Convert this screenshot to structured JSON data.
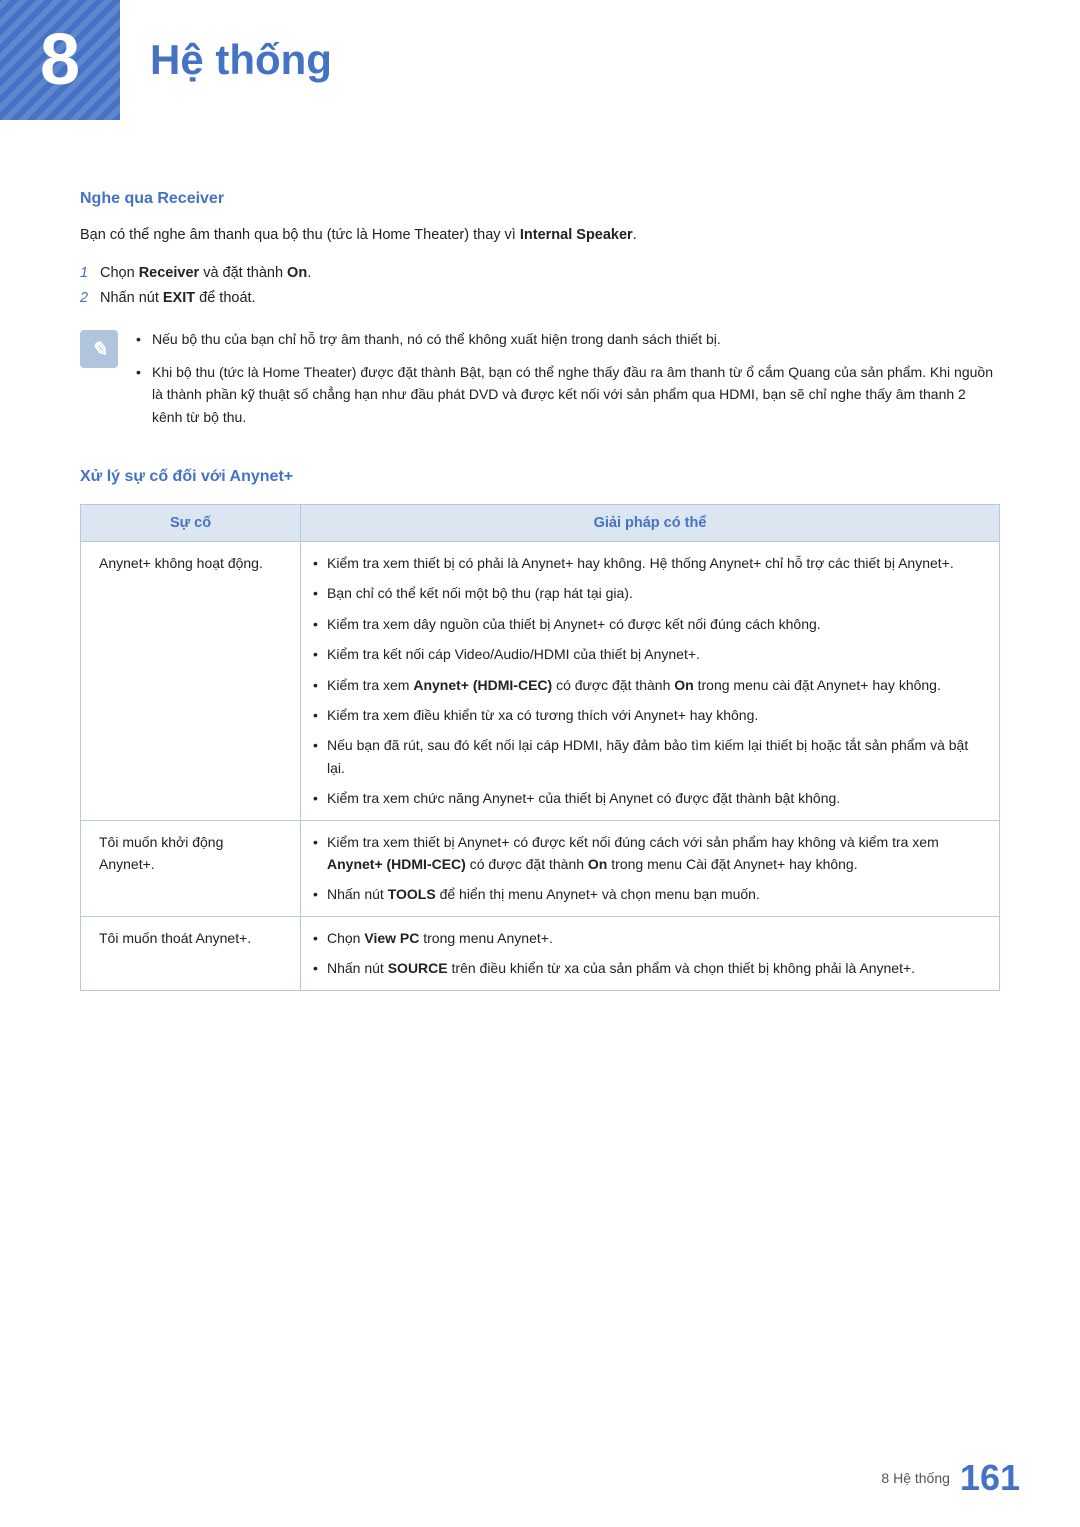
{
  "chapter": {
    "number": "8",
    "title": "Hệ thống"
  },
  "section1": {
    "heading": "Nghe qua Receiver",
    "intro": "Bạn có thể nghe âm thanh qua bộ thu (tức là Home Theater) thay vì ",
    "intro_bold": "Internal Speaker",
    "intro_end": ".",
    "steps": [
      {
        "num": "1",
        "text": "Chọn ",
        "bold": "Receiver",
        "text2": " và đặt thành ",
        "bold2": "On",
        "text3": "."
      },
      {
        "num": "2",
        "text": "Nhấn nút ",
        "bold": "EXIT",
        "text2": " để thoát."
      }
    ],
    "notes": [
      "Nếu bộ thu của bạn chỉ hỗ trợ âm thanh, nó có thể không xuất hiện trong danh sách thiết bị.",
      "Khi bộ thu (tức là Home Theater) được đặt thành Bật, bạn có thể nghe thấy đầu ra âm thanh từ ổ cắm Quang của sản phẩm. Khi nguồn là thành phần kỹ thuật số chẳng hạn như đầu phát DVD và được kết nối với sản phẩm qua HDMI, bạn sẽ chỉ nghe thấy âm thanh 2 kênh từ bộ thu."
    ]
  },
  "section2": {
    "heading": "Xử lý sự cố đối với Anynet+",
    "table": {
      "col1_header": "Sự cố",
      "col2_header": "Giải pháp có thể",
      "rows": [
        {
          "issue": "Anynet+ không hoạt động.",
          "solutions": [
            "Kiểm tra xem thiết bị có phải là Anynet+ hay không. Hệ thống Anynet+ chỉ hỗ trợ các thiết bị Anynet+.",
            "Bạn chỉ có thể kết nối một bộ thu (rạp hát tại gia).",
            "Kiểm tra xem dây nguồn của thiết bị Anynet+ có được kết nối đúng cách không.",
            "Kiểm tra kết nối cáp Video/Audio/HDMI của thiết bị Anynet+.",
            "Kiểm tra xem Anynet+ (HDMI-CEC) có được đặt thành On trong menu cài đặt Anynet+ hay không.",
            "Kiểm tra xem điều khiển từ xa có tương thích với Anynet+ hay không.",
            "Nếu bạn đã rút, sau đó kết nối lại cáp HDMI, hãy đảm bảo tìm kiếm lại thiết bị hoặc tắt sản phẩm và bật lại.",
            "Kiểm tra xem chức năng Anynet+ của thiết bị Anynet có được đặt thành bật không."
          ],
          "solutions_bold": [
            {
              "index": 4,
              "phrase": "Anynet+ (HDMI-CEC)",
              "after": " có được đặt thành ",
              "bold2": "On"
            }
          ]
        },
        {
          "issue": "Tôi muốn khởi động Anynet+.",
          "solutions": [
            "Kiểm tra xem thiết bị Anynet+ có được kết nối đúng cách với sản phẩm hay không và kiểm tra xem Anynet+ (HDMI-CEC) có được đặt thành On trong menu Cài đặt Anynet+ hay không.",
            "Nhấn nút TOOLS để hiển thị menu Anynet+ và chọn menu bạn muốn."
          ],
          "solutions_bold": [
            {
              "index": 0,
              "phrase": "Anynet+ (HDMI-CEC)",
              "after": " có được đặt thành ",
              "bold2": "On"
            },
            {
              "index": 1,
              "phrase": "TOOLS"
            }
          ]
        },
        {
          "issue": "Tôi muốn thoát Anynet+.",
          "solutions": [
            "Chọn View PC trong menu Anynet+.",
            "Nhấn nút SOURCE trên điều khiển từ xa của sản phẩm và chọn thiết bị không phải là Anynet+."
          ],
          "solutions_bold": [
            {
              "index": 0,
              "phrase": "View PC"
            },
            {
              "index": 1,
              "phrase": "SOURCE"
            }
          ]
        }
      ]
    }
  },
  "footer": {
    "section_label": "8 Hệ thống",
    "page_number": "161"
  }
}
